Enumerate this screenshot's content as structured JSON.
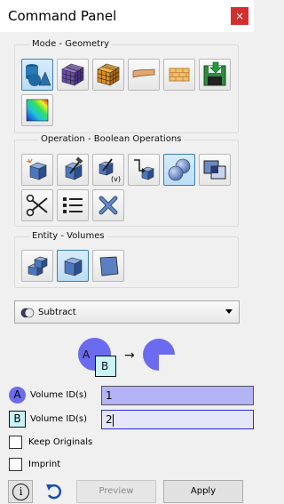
{
  "window": {
    "title": "Command Panel",
    "close_glyph": "×"
  },
  "mode_group": {
    "title": "Mode - Geometry",
    "buttons": [
      {
        "icon": "geometry-shapes-icon",
        "selected": true
      },
      {
        "icon": "mesh-cube-icon",
        "selected": false
      },
      {
        "icon": "mesh-cube-orange-icon",
        "selected": false
      },
      {
        "icon": "boundary-plank-icon",
        "selected": false
      },
      {
        "icon": "brick-wall-icon",
        "selected": false
      },
      {
        "icon": "save-disk-icon",
        "selected": false
      },
      {
        "icon": "color-gradient-icon",
        "selected": false
      }
    ]
  },
  "operation_group": {
    "title": "Operation - Boolean Operations",
    "buttons": [
      {
        "icon": "create-volume-icon",
        "selected": false
      },
      {
        "icon": "modify-volume-icon",
        "selected": false
      },
      {
        "icon": "modify-volume-v-icon",
        "selected": false
      },
      {
        "icon": "transform-volume-icon",
        "selected": false
      },
      {
        "icon": "boolean-spheres-icon",
        "selected": true
      },
      {
        "icon": "overlap-squares-icon",
        "selected": false
      },
      {
        "icon": "scissors-icon",
        "selected": false
      },
      {
        "icon": "list-icon",
        "selected": false
      },
      {
        "icon": "delete-x-icon",
        "selected": false
      }
    ]
  },
  "entity_group": {
    "title": "Entity - Volumes",
    "buttons": [
      {
        "icon": "volume-stack-icon",
        "selected": false
      },
      {
        "icon": "volume-cube-icon",
        "selected": true
      },
      {
        "icon": "volume-face-icon",
        "selected": false
      }
    ]
  },
  "operation_select": {
    "icon": "subtract-circles-icon",
    "selected_value": "Subtract"
  },
  "diagram": {
    "a_letter": "A",
    "b_letter": "B",
    "arrow": "→"
  },
  "fields": {
    "a": {
      "badge": "A",
      "label": "Volume ID(s)",
      "value": "1"
    },
    "b": {
      "badge": "B",
      "label": "Volume ID(s)",
      "value": "2"
    }
  },
  "checkboxes": {
    "keep_originals": {
      "label": "Keep Originals",
      "checked": false
    },
    "imprint": {
      "label": "Imprint",
      "checked": false
    }
  },
  "footer": {
    "info_glyph": "i",
    "preview_label": "Preview",
    "apply_label": "Apply"
  },
  "colors": {
    "accent_blue": "#5b5bf0",
    "field_a_bg": "#b3b3f5",
    "field_b_bg": "#e6e6fb",
    "badge_b_bg": "#c8f3f8"
  }
}
